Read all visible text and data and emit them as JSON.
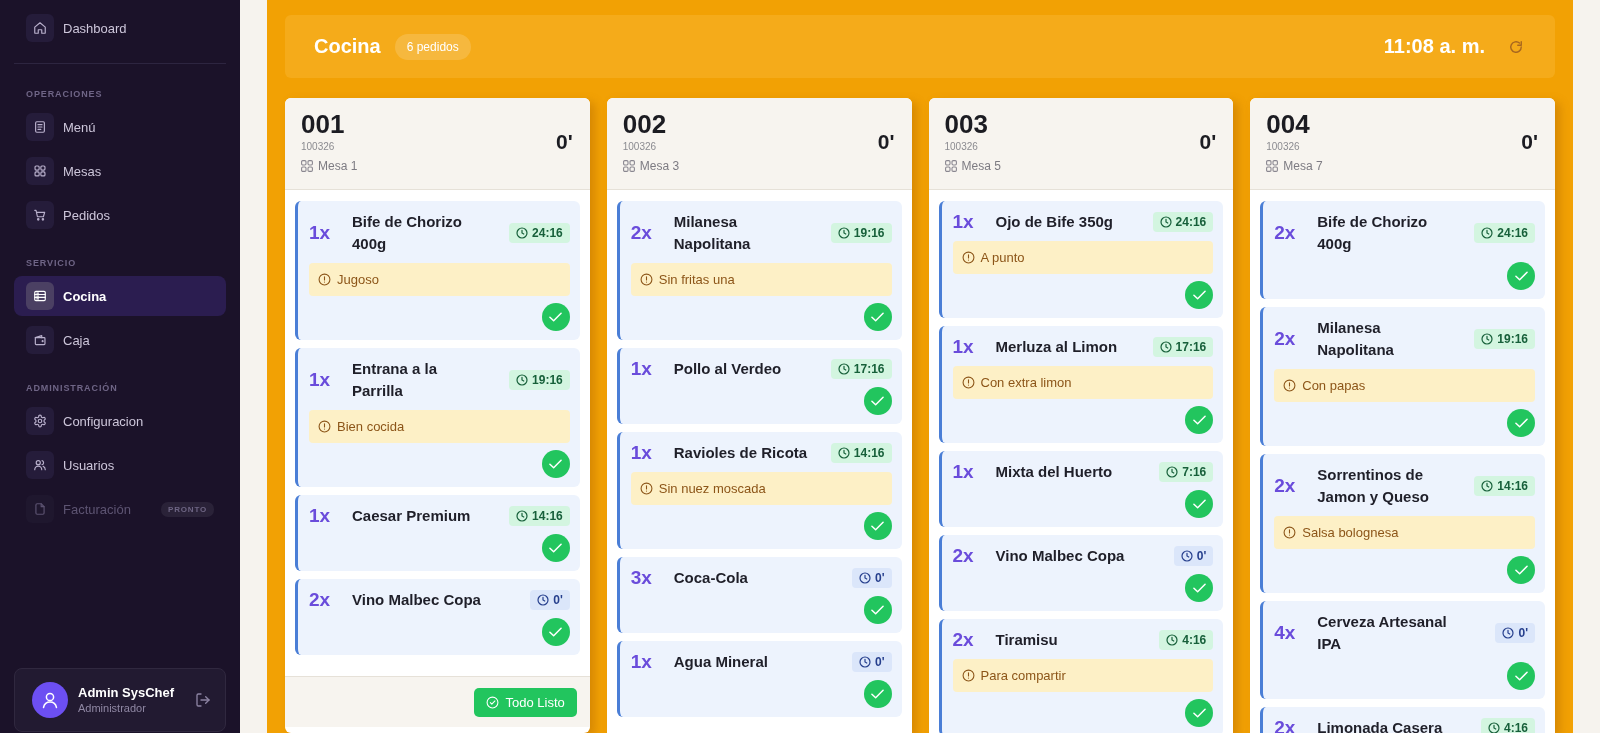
{
  "sidebar": {
    "items": [
      {
        "label": "Dashboard",
        "selected": false,
        "disabled": false
      }
    ],
    "sections": [
      {
        "title": "OPERACIONES",
        "items": [
          {
            "label": "Menú",
            "selected": false,
            "disabled": false
          },
          {
            "label": "Mesas",
            "selected": false,
            "disabled": false
          },
          {
            "label": "Pedidos",
            "selected": false,
            "disabled": false
          }
        ]
      },
      {
        "title": "SERVICIO",
        "items": [
          {
            "label": "Cocina",
            "selected": true,
            "disabled": false
          },
          {
            "label": "Caja",
            "selected": false,
            "disabled": false
          }
        ]
      },
      {
        "title": "ADMINISTRACIÓN",
        "items": [
          {
            "label": "Configuracion",
            "selected": false,
            "disabled": false
          },
          {
            "label": "Usuarios",
            "selected": false,
            "disabled": false
          },
          {
            "label": "Facturación",
            "selected": false,
            "disabled": true,
            "badge": "PRONTO"
          }
        ]
      }
    ],
    "user": {
      "name": "Admin SysChef",
      "role": "Administrador"
    }
  },
  "header": {
    "title": "Cocina",
    "count": "6 pedidos",
    "time": "11:08 a. m."
  },
  "orders": [
    {
      "number": "001",
      "code": "100326",
      "table": "Mesa 1",
      "elapsed": "0'",
      "action": "Todo Listo",
      "items": [
        {
          "qty": "1x",
          "name": "Bife de Chorizo 400g",
          "timer": "24:16",
          "started": true,
          "note": "Jugoso"
        },
        {
          "qty": "1x",
          "name": "Entrana a la Parrilla",
          "timer": "19:16",
          "started": true,
          "note": "Bien cocida"
        },
        {
          "qty": "1x",
          "name": "Caesar Premium",
          "timer": "14:16",
          "started": true
        },
        {
          "qty": "2x",
          "name": "Vino Malbec Copa",
          "timer": "0'",
          "started": false
        }
      ]
    },
    {
      "number": "002",
      "code": "100326",
      "table": "Mesa 3",
      "elapsed": "0'",
      "items": [
        {
          "qty": "2x",
          "name": "Milanesa Napolitana",
          "timer": "19:16",
          "started": true,
          "note": "Sin fritas una"
        },
        {
          "qty": "1x",
          "name": "Pollo al Verdeo",
          "timer": "17:16",
          "started": true
        },
        {
          "qty": "1x",
          "name": "Ravioles de Ricota",
          "timer": "14:16",
          "started": true,
          "note": "Sin nuez moscada"
        },
        {
          "qty": "3x",
          "name": "Coca-Cola",
          "timer": "0'",
          "started": false
        },
        {
          "qty": "1x",
          "name": "Agua Mineral",
          "timer": "0'",
          "started": false
        }
      ]
    },
    {
      "number": "003",
      "code": "100326",
      "table": "Mesa 5",
      "elapsed": "0'",
      "items": [
        {
          "qty": "1x",
          "name": "Ojo de Bife 350g",
          "timer": "24:16",
          "started": true,
          "note": "A punto"
        },
        {
          "qty": "1x",
          "name": "Merluza al Limon",
          "timer": "17:16",
          "started": true,
          "note": "Con extra limon"
        },
        {
          "qty": "1x",
          "name": "Mixta del Huerto",
          "timer": "7:16",
          "started": true
        },
        {
          "qty": "2x",
          "name": "Vino Malbec Copa",
          "timer": "0'",
          "started": false
        },
        {
          "qty": "2x",
          "name": "Tiramisu",
          "timer": "4:16",
          "started": true,
          "note": "Para compartir"
        }
      ]
    },
    {
      "number": "004",
      "code": "100326",
      "table": "Mesa 7",
      "elapsed": "0'",
      "items": [
        {
          "qty": "2x",
          "name": "Bife de Chorizo 400g",
          "timer": "24:16",
          "started": true
        },
        {
          "qty": "2x",
          "name": "Milanesa Napolitana",
          "timer": "19:16",
          "started": true,
          "note": "Con papas"
        },
        {
          "qty": "2x",
          "name": "Sorrentinos de Jamon y Queso",
          "timer": "14:16",
          "started": true,
          "note": "Salsa bolognesa"
        },
        {
          "qty": "4x",
          "name": "Cerveza Artesanal IPA",
          "timer": "0'",
          "started": false
        },
        {
          "qty": "2x",
          "name": "Limonada Casera",
          "timer": "4:16",
          "started": true
        }
      ]
    }
  ]
}
